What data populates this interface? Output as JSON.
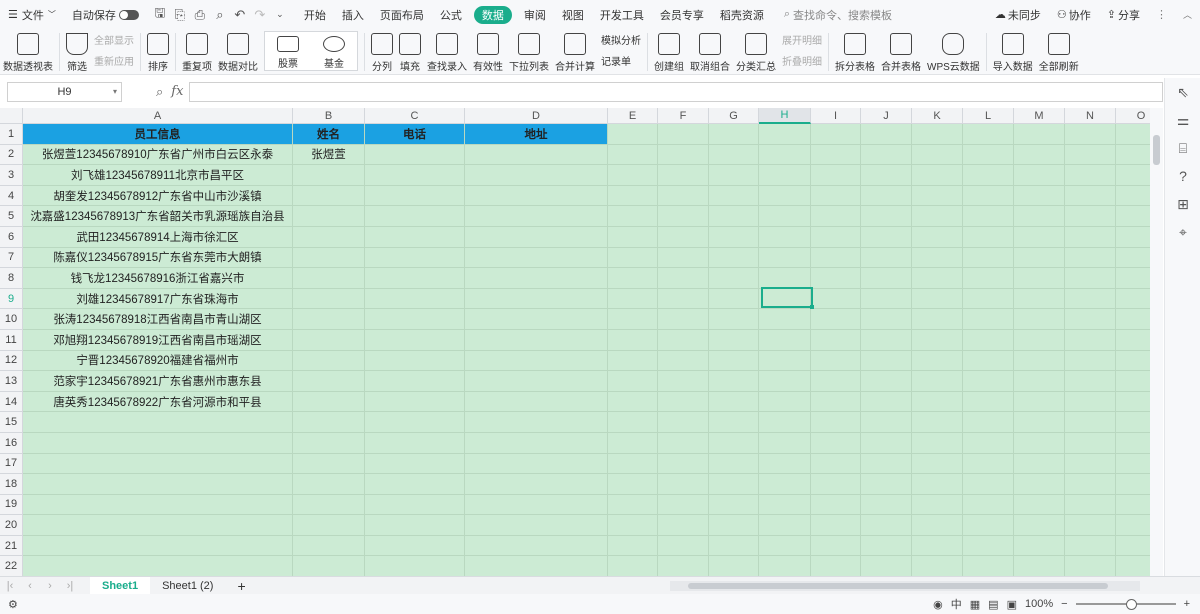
{
  "menubar": {
    "file": "文件",
    "autosave": "自动保存",
    "tabs": [
      "开始",
      "插入",
      "页面布局",
      "公式",
      "数据",
      "审阅",
      "视图",
      "开发工具",
      "会员专享",
      "稻壳资源"
    ],
    "active_tab": "数据",
    "search": "查找命令、搜索模板",
    "sync": "未同步",
    "collab": "协作",
    "share": "分享"
  },
  "ribbon": {
    "pivot": "数据透视表",
    "filter": "筛选",
    "show_all": "全部显示",
    "reapply": "重新应用",
    "sort": "排序",
    "duplicates": "重复项",
    "compare": "数据对比",
    "stock": "股票",
    "fund": "基金",
    "split": "分列",
    "fill": "填充",
    "lookup": "查找录入",
    "validity": "有效性",
    "dropdown": "下拉列表",
    "consolidate": "合并计算",
    "simulate": "模拟分析",
    "records": "记录单",
    "group": "创建组",
    "ungroup": "取消组合",
    "subtotal": "分类汇总",
    "expand": "展开明细",
    "collapse": "折叠明细",
    "split_table": "拆分表格",
    "merge_table": "合并表格",
    "cloud": "WPS云数据",
    "import": "导入数据",
    "refresh": "全部刷新"
  },
  "formula_bar": {
    "cell_ref": "H9",
    "fx": "fx",
    "value": ""
  },
  "columns": [
    "A",
    "B",
    "C",
    "D",
    "E",
    "F",
    "G",
    "H",
    "I",
    "J",
    "K",
    "L",
    "M",
    "N",
    "O"
  ],
  "selected_col": "H",
  "selected_row": "9",
  "rows": [
    {
      "n": "1",
      "a": "员工信息",
      "b": "姓名",
      "c": "电话",
      "d": "地址"
    },
    {
      "n": "2",
      "a": "张煜萱12345678910广东省广州市白云区永泰",
      "b": "张煜萱",
      "c": "",
      "d": ""
    },
    {
      "n": "3",
      "a": "刘飞雄12345678911北京市昌平区",
      "b": "",
      "c": "",
      "d": ""
    },
    {
      "n": "4",
      "a": "胡奎发12345678912广东省中山市沙溪镇",
      "b": "",
      "c": "",
      "d": ""
    },
    {
      "n": "5",
      "a": "沈嘉盛12345678913广东省韶关市乳源瑶族自治县",
      "b": "",
      "c": "",
      "d": ""
    },
    {
      "n": "6",
      "a": "武田12345678914上海市徐汇区",
      "b": "",
      "c": "",
      "d": ""
    },
    {
      "n": "7",
      "a": "陈嘉仪12345678915广东省东莞市大朗镇",
      "b": "",
      "c": "",
      "d": ""
    },
    {
      "n": "8",
      "a": "钱飞龙12345678916浙江省嘉兴市",
      "b": "",
      "c": "",
      "d": ""
    },
    {
      "n": "9",
      "a": "刘雄12345678917广东省珠海市",
      "b": "",
      "c": "",
      "d": ""
    },
    {
      "n": "10",
      "a": "张涛12345678918江西省南昌市青山湖区",
      "b": "",
      "c": "",
      "d": ""
    },
    {
      "n": "11",
      "a": "邓旭翔12345678919江西省南昌市瑶湖区",
      "b": "",
      "c": "",
      "d": ""
    },
    {
      "n": "12",
      "a": "宁晋12345678920福建省福州市",
      "b": "",
      "c": "",
      "d": ""
    },
    {
      "n": "13",
      "a": "范家宇12345678921广东省惠州市惠东县",
      "b": "",
      "c": "",
      "d": ""
    },
    {
      "n": "14",
      "a": "唐英秀12345678922广东省河源市和平县",
      "b": "",
      "c": "",
      "d": ""
    },
    {
      "n": "15",
      "a": "",
      "b": "",
      "c": "",
      "d": ""
    },
    {
      "n": "16",
      "a": "",
      "b": "",
      "c": "",
      "d": ""
    },
    {
      "n": "17",
      "a": "",
      "b": "",
      "c": "",
      "d": ""
    },
    {
      "n": "18",
      "a": "",
      "b": "",
      "c": "",
      "d": ""
    },
    {
      "n": "19",
      "a": "",
      "b": "",
      "c": "",
      "d": ""
    },
    {
      "n": "20",
      "a": "",
      "b": "",
      "c": "",
      "d": ""
    },
    {
      "n": "21",
      "a": "",
      "b": "",
      "c": "",
      "d": ""
    },
    {
      "n": "22",
      "a": "",
      "b": "",
      "c": "",
      "d": ""
    }
  ],
  "sheet_tabs": [
    "Sheet1",
    "Sheet1 (2)"
  ],
  "add_sheet": "+",
  "status": {
    "zoom": "100%",
    "lang": "中"
  },
  "colors": {
    "accent": "#1aad8c",
    "header_fill": "#1ba1e2",
    "sheet_bg": "#ccebd4"
  }
}
